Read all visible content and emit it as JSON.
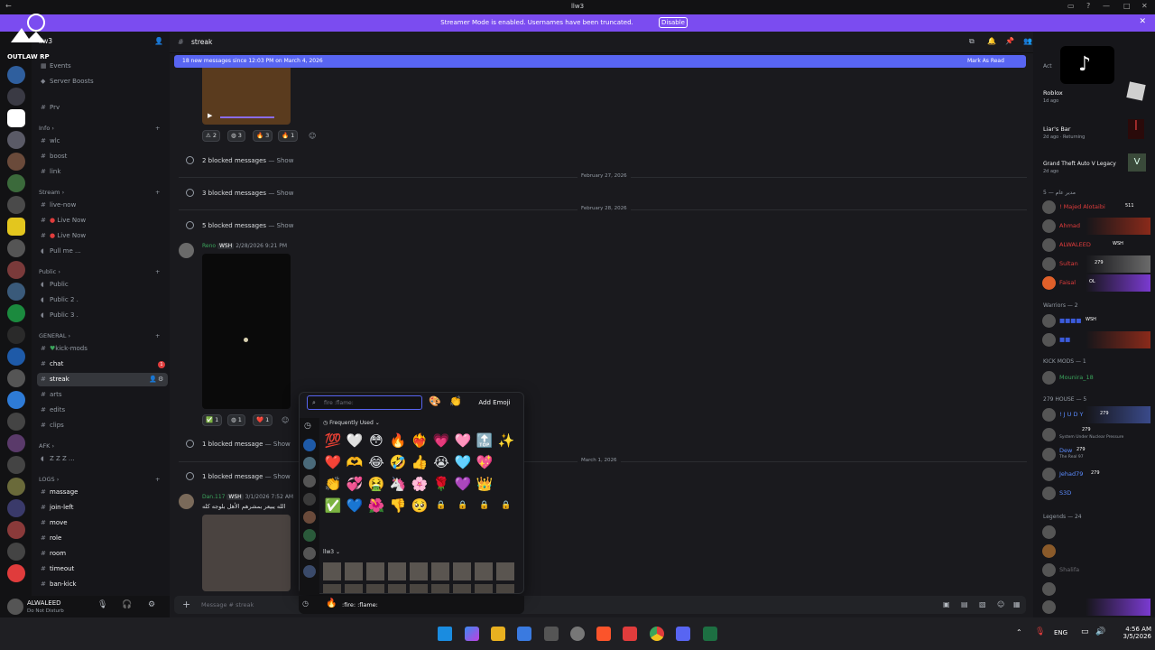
{
  "titlebar": {
    "title": "llw3"
  },
  "streamer": {
    "message": "Streamer Mode is enabled. Usernames have been truncated.",
    "button": "Disable"
  },
  "server": {
    "name": "llw3",
    "logo_text": "OUTLAW RP"
  },
  "channels": {
    "events": "Events",
    "boosts": "Server Boosts",
    "prv": "Prv",
    "cat_info": "Info",
    "wlc": "wlc",
    "boost": "boost",
    "link": "link",
    "cat_stream": "Stream",
    "live_now_a": "live-now",
    "live_now_b": "Live Now",
    "live_now_c": "Live Now",
    "pull": "Pull me ...",
    "cat_public": "Public",
    "public1": "Public",
    "public2": "Public 2 .",
    "public3": "Public 3 .",
    "cat_general": "GENERAL",
    "kick_mods": "kick-mods",
    "chat": "chat",
    "chat_badge": "1",
    "streak": "streak",
    "arts": "arts",
    "edits": "edits",
    "clips": "clips",
    "cat_afk": "AFK",
    "zzz": "Z Z Z ...",
    "cat_logs": "LOGS",
    "massage": "massage",
    "join_left": "join-left",
    "move": "move",
    "role": "role",
    "room": "room",
    "timeout": "timeout",
    "ban_kick": "ban-kick"
  },
  "user": {
    "name": "ALWALEED",
    "status": "Do Not Disturb"
  },
  "header": {
    "channel": "streak"
  },
  "newbar": {
    "text": "18 new messages since 12:03 PM on March 4, 2026",
    "mark": "Mark As Read"
  },
  "chat": {
    "reactions_top": [
      "2",
      "3",
      "3",
      "1"
    ],
    "blocked2": "2 blocked messages",
    "blocked3": "3 blocked messages",
    "blocked5": "5 blocked messages",
    "show": "— Show",
    "date1": "February 27, 2026",
    "date2": "February 28, 2026",
    "date3": "March 1, 2026",
    "reno_name": "Reno",
    "reno_tag": "WSH",
    "reno_time": "2/28/2026 9:21 PM",
    "reactions_mid": [
      "1",
      "1",
      "1"
    ],
    "blocked1a": "1 blocked message",
    "blocked1b": "1 blocked message",
    "dan_name": "Dan.117",
    "dan_tag": "WSH",
    "dan_time": "3/1/2026 7:52 AM",
    "dan_text": "الله يبيعر بمشرهم الأهل بلوجه كله"
  },
  "composer": {
    "placeholder": "Message # streak",
    "autocomplete": ":fire: :flame:"
  },
  "picker": {
    "search_placeholder": "fire :flame:",
    "add_emoji": "Add Emoji",
    "frequently_used": "Frequently Used",
    "server_section": "llw3",
    "emojis_row1": [
      "💯",
      "🤍",
      "😳",
      "🔥",
      "❤️‍🔥",
      "💗",
      "🩷",
      "🔝",
      "✨"
    ],
    "emojis_row2": [
      "❤️",
      "🫶",
      "😂",
      "🤣",
      "👍",
      "😭",
      "🩵",
      "💖"
    ],
    "emojis_row3": [
      "👏",
      "💞",
      "🤮",
      "🦄",
      "🌸",
      "🌹",
      "💜",
      "👑"
    ],
    "emojis_row4": [
      "✅",
      "💙",
      "🌺",
      "👎",
      "🥺",
      "🔒",
      "🔒",
      "🔒",
      "🔒"
    ]
  },
  "members": {
    "activity_label": "Act",
    "act1_title": "Roblox",
    "act1_time": "1d ago",
    "act2_title": "Liar's Bar",
    "act2_time": "2d ago",
    "act2_status": "Returning",
    "act3_title": "Grand Theft Auto V Legacy",
    "act3_time": "2d ago",
    "cat1": "مدير عام — 5",
    "m1": "! Majed Alotaibi",
    "m1_tag": "511",
    "m2": "Ahmad",
    "m3": "ALWALEED",
    "m3_tag": "WSH",
    "m4": "Sultan",
    "m4_tag": "279",
    "m5": "Faisal",
    "m5_tag": "OL",
    "cat2": "Warriors — 2",
    "w1_tag": "WSH",
    "cat3": "KICK MODS — 1",
    "k1": "Mounira_18",
    "cat4": "279 HOUSE — 5",
    "h1": "! J U D Y",
    "h1_tag": "279",
    "h2_tag": "279",
    "h2_status": "System Under Nuclear Pressure",
    "h3": "Dew",
    "h3_tag": "279",
    "h3_status": "The Real 97",
    "h4": "Jehad79",
    "h4_tag": "279",
    "h5": "S3D",
    "cat5": "Legends — 24",
    "l2": "Shalifa"
  },
  "taskbar": {
    "lang": "ENG",
    "time": "4:56 AM",
    "date": "3/5/2026"
  }
}
